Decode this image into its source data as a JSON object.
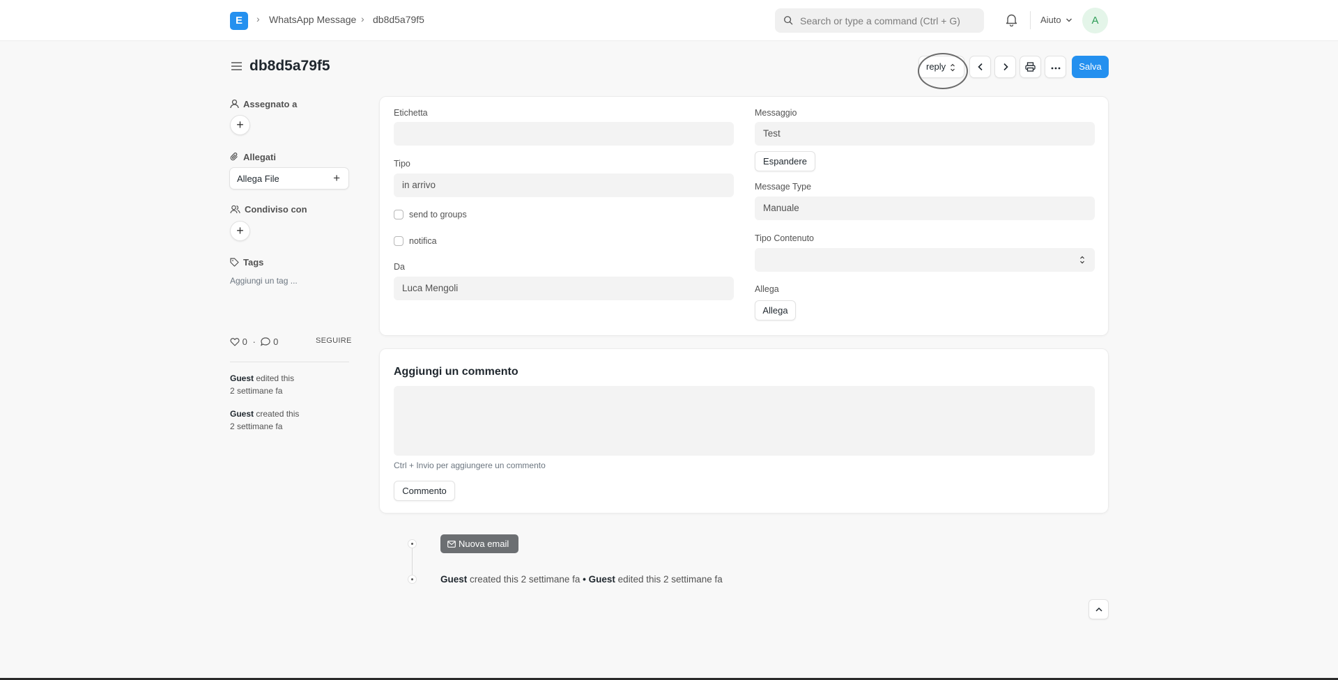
{
  "navbar": {
    "logo_letter": "E",
    "breadcrumbs": [
      "WhatsApp Message",
      "db8d5a79f5"
    ],
    "search_placeholder": "Search or type a command (Ctrl + G)",
    "help_label": "Aiuto",
    "avatar_initial": "A"
  },
  "page": {
    "title": "db8d5a79f5",
    "reply_label": "reply",
    "save_label": "Salva"
  },
  "sidebar": {
    "assigned_to": "Assegnato a",
    "attachments": "Allegati",
    "attach_file": "Allega File",
    "shared_with": "Condiviso con",
    "tags": "Tags",
    "add_tag": "Aggiungi un tag ...",
    "likes": "0",
    "comments": "0",
    "follow": "SEGUIRE",
    "activity": [
      {
        "user": "Guest",
        "action": "edited this",
        "time": "2 settimane fa"
      },
      {
        "user": "Guest",
        "action": "created this",
        "time": "2 settimane fa"
      }
    ]
  },
  "form": {
    "label_field": {
      "label": "Etichetta",
      "value": ""
    },
    "type_field": {
      "label": "Tipo",
      "value": "in arrivo"
    },
    "send_to_groups": {
      "label": "send to groups",
      "checked": false
    },
    "notification": {
      "label": "notifica",
      "checked": false
    },
    "from_field": {
      "label": "Da",
      "value": "Luca Mengoli"
    },
    "message_field": {
      "label": "Messaggio",
      "value": "Test"
    },
    "expand_label": "Espandere",
    "message_type": {
      "label": "Message Type",
      "value": "Manuale"
    },
    "content_type": {
      "label": "Tipo Contenuto",
      "value": ""
    },
    "attach": {
      "label": "Allega",
      "button": "Allega"
    }
  },
  "comment": {
    "title": "Aggiungi un commento",
    "hint": "Ctrl + Invio per aggiungere un commento",
    "button": "Commento"
  },
  "timeline": {
    "new_email": "Nuova email",
    "user1": "Guest",
    "action1": "created this 2 settimane fa",
    "separator": "•",
    "user2": "Guest",
    "action2": "edited this 2 settimane fa"
  },
  "colors": {
    "primary": "#2490ef",
    "page_bg": "#f8f8f8",
    "input_bg": "#f3f3f3"
  }
}
